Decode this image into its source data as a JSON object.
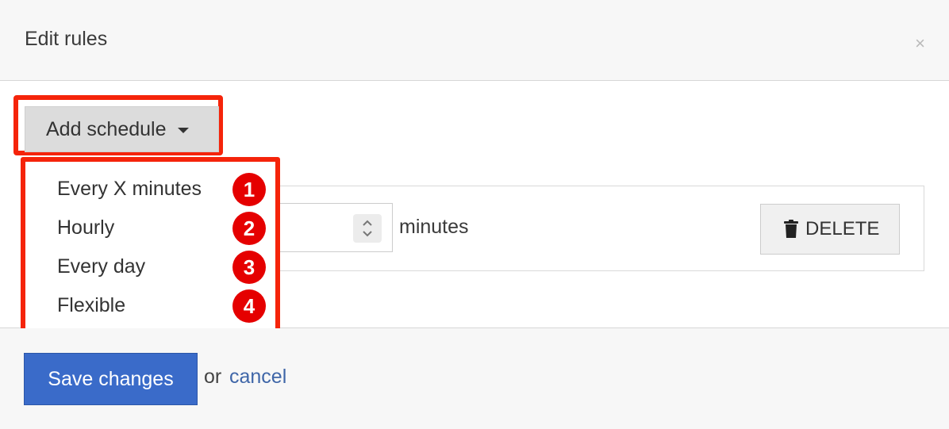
{
  "dialog": {
    "title": "Edit rules",
    "close_glyph": "×"
  },
  "add_schedule": {
    "label": "Add schedule"
  },
  "menu": {
    "items": [
      {
        "label": "Every X minutes",
        "badge": "1"
      },
      {
        "label": "Hourly",
        "badge": "2"
      },
      {
        "label": "Every day",
        "badge": "3"
      },
      {
        "label": "Flexible",
        "badge": "4"
      }
    ]
  },
  "rule": {
    "unit_label": "minutes",
    "delete_label": "DELETE"
  },
  "footer": {
    "save_label": "Save changes",
    "or_text": "or",
    "cancel_label": "cancel"
  },
  "colors": {
    "highlight": "#f5240a",
    "badge": "#e50000",
    "primary": "#3a6bc9",
    "link": "#3f66a8"
  },
  "icons": {
    "close": "close-icon",
    "caret": "caret-down-icon",
    "spinner": "spinner-arrows-icon",
    "trash": "trash-icon"
  }
}
